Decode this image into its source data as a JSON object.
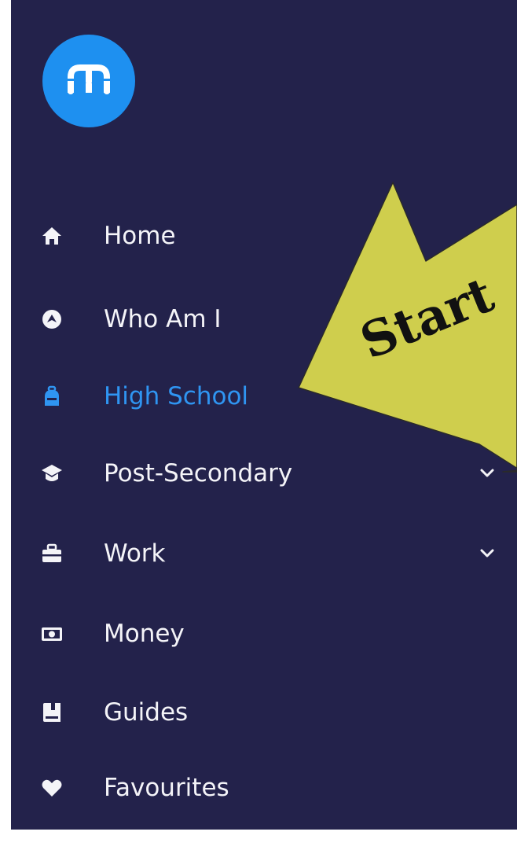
{
  "sidebar": {
    "logo_icon": "brand-logo-icon",
    "items": [
      {
        "label": "Home",
        "icon": "home-icon",
        "has_chevron": true,
        "active": false
      },
      {
        "label": "Who Am I",
        "icon": "compass-icon",
        "has_chevron": false,
        "active": false
      },
      {
        "label": "High School",
        "icon": "backpack-icon",
        "has_chevron": false,
        "active": true
      },
      {
        "label": "Post-Secondary",
        "icon": "graduation-cap-icon",
        "has_chevron": true,
        "active": false
      },
      {
        "label": "Work",
        "icon": "briefcase-icon",
        "has_chevron": true,
        "active": false
      },
      {
        "label": "Money",
        "icon": "money-bill-icon",
        "has_chevron": false,
        "active": false
      },
      {
        "label": "Guides",
        "icon": "book-icon",
        "has_chevron": false,
        "active": false
      },
      {
        "label": "Favourites",
        "icon": "heart-icon",
        "has_chevron": false,
        "active": false
      }
    ]
  },
  "annotation": {
    "text": "Start"
  },
  "colors": {
    "sidebar_bg": "#23224b",
    "brand": "#1e90f0",
    "active": "#2f95f2",
    "text": "#f4f4f8",
    "arrow_fill": "#cfce4d"
  }
}
